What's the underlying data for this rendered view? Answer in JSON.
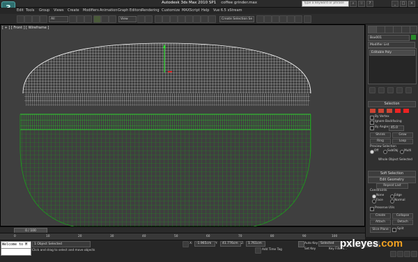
{
  "title_bar": {
    "app_name": "Autodesk 3ds Max  2010 SP1",
    "file_name": "coffee grinder.max",
    "search_placeholder": "Type a keyword or phrase"
  },
  "menus": [
    "Edit",
    "Tools",
    "Group",
    "Views",
    "Create",
    "Modifiers",
    "Animation",
    "Graph Editors",
    "Rendering",
    "Customize",
    "MAXScript",
    "Help",
    "Vue 6.5 xStream"
  ],
  "toolbar": {
    "filter_dropdown": "All",
    "view_dropdown": "View",
    "create_selection_set": "Create Selection Se"
  },
  "viewport": {
    "label": "[ + ] [ Front ] [ Wireframe ]",
    "colors": {
      "background": "#3f3f3f",
      "dome_wire": "#ffffff",
      "body_wire": "#14a014"
    }
  },
  "command_panel": {
    "object_name": "Box001",
    "modifier_list": "Modifier List",
    "stack_item": "Editable Poly",
    "selection": {
      "title": "Selection",
      "by_vertex": "By Vertex",
      "ignore_backfacing": "Ignore Backfacing",
      "by_angle": "By Angle:",
      "angle_value": "45.0",
      "shrink": "Shrink",
      "grow": "Grow",
      "ring": "Ring",
      "loop": "Loop",
      "preview_selection": "Preview Selection",
      "off": "Off",
      "subobj": "SubObj",
      "multi": "Multi",
      "status": "Whole Object Selected"
    },
    "soft_selection": "Soft Selection",
    "edit_geometry": {
      "title": "Edit Geometry",
      "repeat_last": "Repeat Last",
      "constraints": "Constraints",
      "none": "None",
      "edge": "Edge",
      "face": "Face",
      "normal": "Normal",
      "preserve_uvs": "Preserve UVs",
      "create": "Create",
      "collapse": "Collapse",
      "attach": "Attach",
      "detach": "Detach",
      "slice_plane": "Slice Plane",
      "split": "Split"
    }
  },
  "timeline": {
    "frame": "0 / 100",
    "ticks": [
      "0",
      "10",
      "20",
      "30",
      "40",
      "50",
      "60",
      "70",
      "80",
      "90",
      "100"
    ]
  },
  "status_bar": {
    "maxscript_line": "Welcome to M",
    "selected": "1 Object Selected",
    "prompt": "Click and drag to select and move objects",
    "x_label": "X:",
    "x_value": "-1.965cm",
    "y_label": "Y:",
    "y_value": "41.776cm",
    "z_label": "Z:",
    "z_value": "1.761cm",
    "add_time_tag": "Add Time Tag",
    "auto_key": "Auto Key",
    "key_mode": "Selected",
    "set_key": "Set Key",
    "key_filters": "Key Filters..."
  },
  "watermark": {
    "text": "pxleyes",
    "suffix": ".com"
  }
}
